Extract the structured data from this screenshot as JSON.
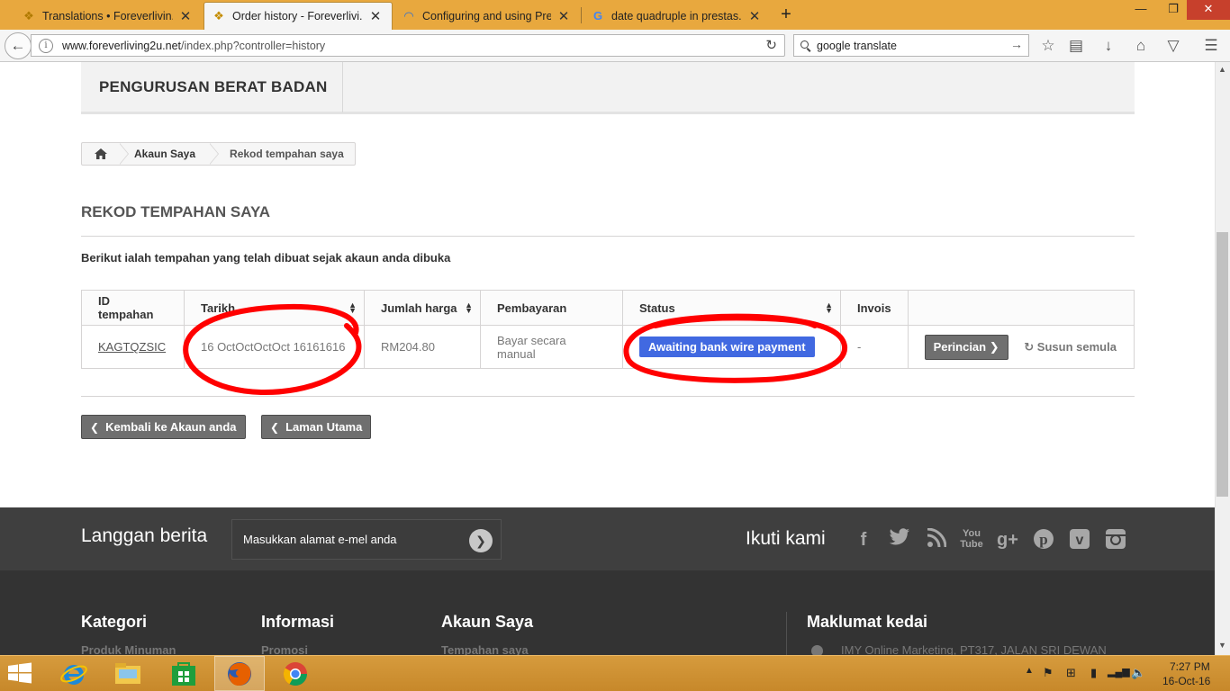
{
  "browser": {
    "tabs": [
      {
        "title": "Translations • Foreverlivin...",
        "icon": "foreverliving-favicon",
        "active": false
      },
      {
        "title": "Order history - Foreverlivi...",
        "icon": "foreverliving-favicon",
        "active": true
      },
      {
        "title": "Configuring and using Pre...",
        "icon": "loading-spinner-icon",
        "active": false
      },
      {
        "title": "date quadruple in prestas...",
        "icon": "google-favicon",
        "active": false
      }
    ],
    "url_domain": "www.foreverliving2u.net",
    "url_path": "/index.php?controller=history",
    "search_value": "google translate",
    "window_buttons": {
      "minimize": "—",
      "restore": "❐",
      "close": "✕"
    }
  },
  "header": {
    "nav_item": "PENGURUSAN BERAT BADAN"
  },
  "breadcrumb": {
    "account": "Akaun Saya",
    "current": "Rekod tempahan saya"
  },
  "page": {
    "heading": "REKOD TEMPAHAN SAYA",
    "intro": "Berikut ialah tempahan yang telah dibuat sejak akaun anda dibuka"
  },
  "orders_table": {
    "columns": [
      "ID tempahan",
      "Tarikh",
      "Jumlah harga",
      "Pembayaran",
      "Status",
      "Invois",
      ""
    ],
    "rows": [
      {
        "ref": "KAGTQZSIC",
        "date": "16 OctOctOctOct 16161616",
        "total": "RM204.80",
        "payment": "Bayar secara manual",
        "status": "Awaiting bank wire payment",
        "invoice": "-",
        "details_label": "Perincian",
        "reorder_label": "Susun semula"
      }
    ],
    "status_color": "#4169e1"
  },
  "page_nav": {
    "back_account": "Kembali ke Akaun anda",
    "home": "Laman Utama"
  },
  "newsletter": {
    "title": "Langgan berita",
    "placeholder": "Masukkan alamat e-mel anda"
  },
  "social": {
    "title": "Ikuti kami",
    "icons": [
      "facebook-icon",
      "twitter-icon",
      "rss-icon",
      "youtube-icon",
      "google-plus-icon",
      "pinterest-icon",
      "vimeo-icon",
      "instagram-icon"
    ]
  },
  "footer": {
    "columns": [
      {
        "title": "Kategori",
        "first_item": "Produk Minuman"
      },
      {
        "title": "Informasi",
        "first_item": "Promosi"
      },
      {
        "title": "Akaun Saya",
        "first_item": "Tempahan saya"
      },
      {
        "title": "Maklumat kedai",
        "first_item": "IMY Online Marketing, PT317, JALAN SRI DEWAN"
      }
    ]
  },
  "taskbar": {
    "time": "7:27 PM",
    "date": "16-Oct-16"
  },
  "colors": {
    "tabbar": "#e8a83e",
    "footer_dark": "#333333",
    "newsletter_band": "#3f3f3f",
    "annotation_red": "#ff0000"
  }
}
